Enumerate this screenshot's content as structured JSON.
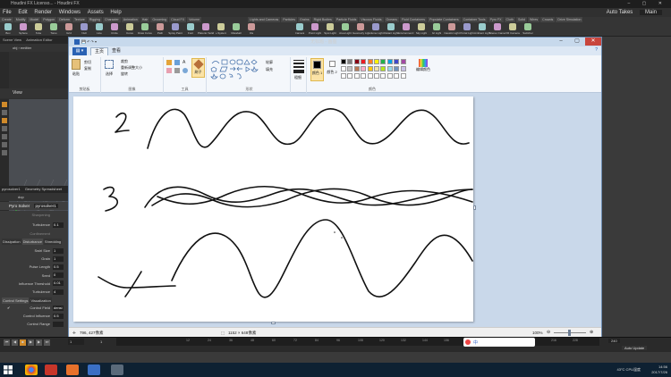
{
  "houdini": {
    "title": "Houdini FX Licenso... - Houdini FX",
    "menu": [
      "File",
      "Edit",
      "Render",
      "Windows",
      "Assets",
      "Help"
    ],
    "build_label": "Auto Takes",
    "desktop_label": "Main",
    "shelf_tabs_left": [
      "Create",
      "Modify",
      "Model",
      "Polygon",
      "Deform",
      "Texture",
      "Rigging",
      "Character",
      "Animation",
      "Hair",
      "Grooming",
      "Cloud FX",
      "Volume"
    ],
    "shelf_tabs_right": [
      "Lights and Cameras",
      "Particles",
      "Grains",
      "Rigid Bodies",
      "Particle Fluids",
      "Viscous Fluids",
      "Oceans",
      "Fluid Containers",
      "Populate Containers",
      "Container Tools",
      "Pyro FX",
      "Cloth",
      "Solid",
      "Wires",
      "Crowds",
      "Drive Simulation"
    ],
    "shelf_tools_left": [
      "Box",
      "Sphere",
      "Tube",
      "Torus",
      "Grid",
      "Null",
      "Line",
      "Circle",
      "Curve",
      "Draw Curve",
      "Path",
      "Spray Paint",
      "Font",
      "Platonic Solids",
      "L-System",
      "Metaball",
      "File"
    ],
    "shelf_tools_right": [
      "Camera",
      "Point Light",
      "Spot Light",
      "Area Light",
      "Geometry Light",
      "Volume Light",
      "Distant Light",
      "Environment Light",
      "Sky Light",
      "GI Light",
      "Caustic Light",
      "Portal Light",
      "Ambient Light",
      "Stereo Camera",
      "VR Camera",
      "Switcher"
    ],
    "pane_tabs": [
      "Scene View",
      "Animation Editor"
    ],
    "path_obj": "obj",
    "path_node": "emitter",
    "view_label": "View",
    "network_tabs": [
      "pyrosolver1",
      "Geometry Spreadsheet"
    ],
    "net_path": "dop",
    "node_type": "Pyro Solver",
    "node_name": "pyrosolver1",
    "params": [
      {
        "label": "Sharpening",
        "value": ""
      },
      {
        "label": "Turbulence",
        "value": "0.1"
      },
      {
        "label": "Confinement",
        "value": ""
      }
    ],
    "subtabs": [
      "Dissipation",
      "Disturbance",
      "Shredding"
    ],
    "params2": [
      {
        "label": "Swirl Size",
        "value": "1"
      },
      {
        "label": "Grain",
        "value": "1"
      },
      {
        "label": "Pulse Length",
        "value": "0.5"
      },
      {
        "label": "Seed",
        "value": "0"
      },
      {
        "label": "Influence Threshold",
        "value": "0.01"
      },
      {
        "label": "Turbulence",
        "value": "4"
      }
    ],
    "subtabs2": [
      "Control Settings",
      "Visualization"
    ],
    "params3": [
      {
        "label": "Control Field",
        "value": "densi"
      },
      {
        "label": "Control Influence",
        "value": "0.5"
      },
      {
        "label": "Control Range",
        "value": ""
      }
    ],
    "timeline_start": "1",
    "timeline_end": "240",
    "frame": "1",
    "ticks": [
      "12",
      "24",
      "36",
      "48",
      "60",
      "72",
      "84",
      "96",
      "108",
      "120",
      "132",
      "144",
      "156",
      "168",
      "180",
      "192",
      "204",
      "216",
      "228"
    ],
    "update_mode": "Auto Update"
  },
  "paint": {
    "title": "无标题 - 画图",
    "file_tab": "",
    "tabs": [
      "主页",
      "查看"
    ],
    "groups": {
      "clipboard": {
        "label": "剪贴板",
        "paste": "粘贴",
        "cut": "剪切",
        "copy": "复制"
      },
      "image": {
        "label": "图像",
        "select": "选择",
        "crop": "裁剪",
        "resize": "重新调整大小",
        "rotate": "旋转"
      },
      "tools": {
        "label": "工具",
        "brush": "刷子"
      },
      "shapes": {
        "label": "形状",
        "outline": "轮廓",
        "fill": "填充"
      },
      "size": {
        "label": "粗细"
      },
      "colors": {
        "label": "颜色",
        "color1": "颜色 1",
        "color2": "颜色 2",
        "edit": "编辑颜色"
      }
    },
    "palette": [
      "#000000",
      "#7f7f7f",
      "#880015",
      "#ed1c24",
      "#ff7f27",
      "#fff200",
      "#22b14c",
      "#00a2e8",
      "#3f48cc",
      "#a349a4",
      "#ffffff",
      "#c3c3c3",
      "#b97a57",
      "#ffaec9",
      "#ffc90e",
      "#efe4b0",
      "#b5e61d",
      "#99d9ea",
      "#7092be",
      "#c8bfe7",
      "#ffffff",
      "#ffffff",
      "#ffffff",
      "#ffffff",
      "#ffffff",
      "#ffffff",
      "#ffffff",
      "#ffffff",
      "#ffffff",
      "#ffffff"
    ],
    "status_pos": "796, 427像素",
    "status_size": "1152 × 648像素",
    "zoom": "100%"
  },
  "taskbar": {
    "tray_text": "43°C CPU温度",
    "time": "14:56",
    "date": "2017/7/26",
    "ime": "中"
  }
}
